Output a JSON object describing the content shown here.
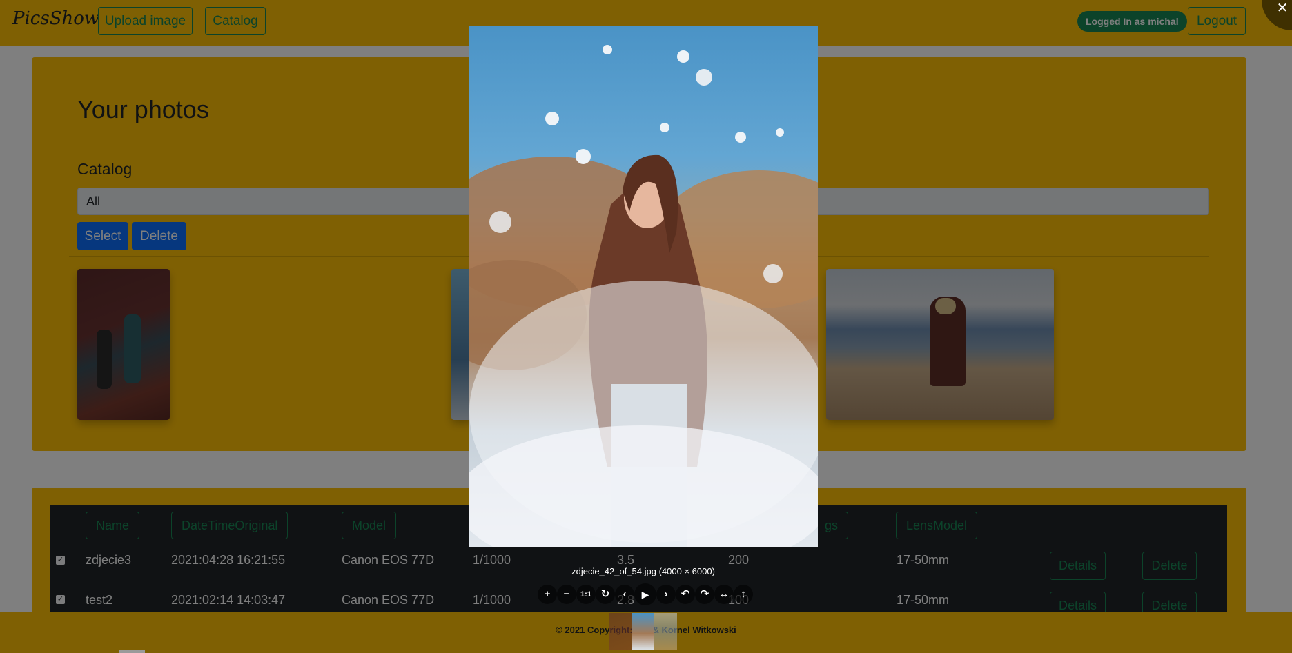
{
  "navbar": {
    "brand": "PicsShow",
    "upload_label": "Upload image",
    "catalog_label": "Catalog",
    "user_badge": "Logged In as michal",
    "logout_label": "Logout"
  },
  "photos_section": {
    "title": "Your photos",
    "catalog_heading": "Catalog",
    "catalog_selected": "All",
    "select_label": "Select",
    "delete_label": "Delete"
  },
  "table": {
    "headers": [
      "Name",
      "DateTimeOriginal",
      "Model",
      "",
      "",
      "",
      "LensModel"
    ],
    "header_partial": "gs",
    "rows": [
      {
        "checked": true,
        "name": "zdjecie3",
        "date": "2021:04:28 16:21:55",
        "model": "Canon EOS 77D",
        "exposure": "1/1000",
        "fnumber": "3.5",
        "iso": "200",
        "lens": "17-50mm",
        "details_label": "Details",
        "delete_label": "Delete"
      },
      {
        "checked": true,
        "name": "test2",
        "date": "2021:02:14 14:03:47",
        "model": "Canon EOS 77D",
        "exposure": "1/1000",
        "fnumber": "2.8",
        "iso": "100",
        "lens": "17-50mm",
        "details_label": "Details",
        "delete_label": "Delete"
      }
    ]
  },
  "footer": {
    "text": "© 2021 Copyright: M... & Kornel Witkowski"
  },
  "viewer": {
    "caption": "zdjecie_42_of_54.jpg (4000 × 6000)",
    "close_glyph": "✕",
    "toolbar": [
      {
        "name": "zoom-in",
        "glyph": "+"
      },
      {
        "name": "zoom-out",
        "glyph": "−"
      },
      {
        "name": "one-to-one",
        "glyph": "1:1"
      },
      {
        "name": "reset",
        "glyph": "↻"
      },
      {
        "name": "prev",
        "glyph": "‹"
      },
      {
        "name": "play",
        "glyph": "▶"
      },
      {
        "name": "next",
        "glyph": "›"
      },
      {
        "name": "rotate-left",
        "glyph": "↶"
      },
      {
        "name": "rotate-right",
        "glyph": "↷"
      },
      {
        "name": "flip-horizontal",
        "glyph": "↔"
      },
      {
        "name": "flip-vertical",
        "glyph": "↕"
      }
    ]
  },
  "colors": {
    "brand_yellow": "#ffc107",
    "success_green": "#198754",
    "primary_blue": "#0d6efd",
    "table_dark": "#212529"
  }
}
